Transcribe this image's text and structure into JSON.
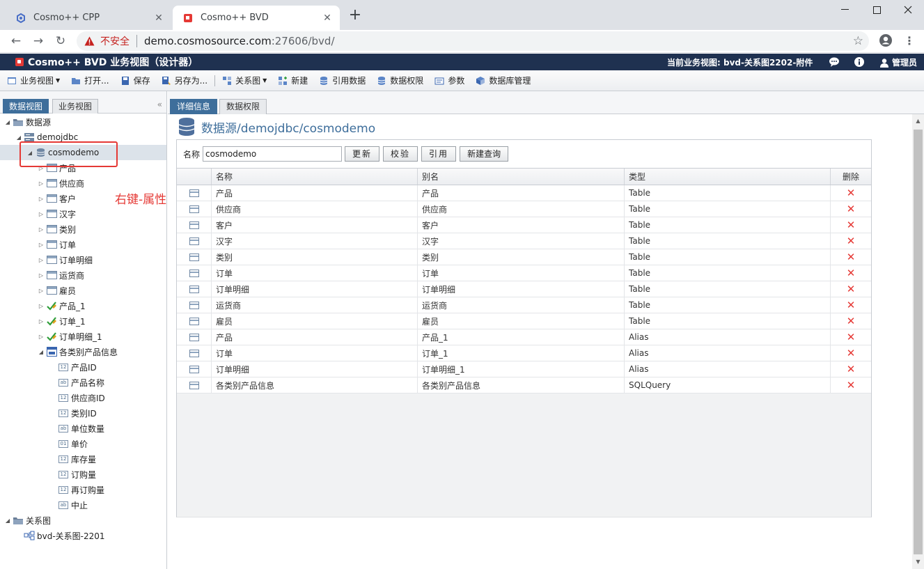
{
  "browser": {
    "tabs": [
      {
        "label": "Cosmo++ CPP",
        "active": false,
        "icon": "cosmo-cpp-icon"
      },
      {
        "label": "Cosmo++ BVD",
        "active": true,
        "icon": "cosmo-bvd-icon"
      }
    ],
    "insecure_label": "不安全",
    "url_host": "demo.cosmosource.com",
    "url_path": ":27606/bvd/"
  },
  "app": {
    "title": "Cosmo++ BVD 业务视图（设计器）",
    "current_view": "当前业务视图: bvd-关系图2202-附件",
    "user": "管理员",
    "header_color": "#1f3150"
  },
  "toolbar": {
    "items": [
      {
        "label": "业务视图",
        "icon": "business-view-icon",
        "dropdown": true
      },
      {
        "label": "打开...",
        "icon": "open-icon"
      },
      {
        "label": "保存",
        "icon": "save-icon"
      },
      {
        "label": "另存为...",
        "icon": "save-as-icon"
      },
      {
        "label": "关系图",
        "icon": "diagram-icon",
        "dropdown": true
      },
      {
        "label": "新建",
        "icon": "new-icon"
      },
      {
        "label": "引用数据",
        "icon": "reference-data-icon"
      },
      {
        "label": "数据权限",
        "icon": "data-permission-icon"
      },
      {
        "label": "参数",
        "icon": "params-icon"
      },
      {
        "label": "数据库管理",
        "icon": "db-manage-icon"
      }
    ]
  },
  "left": {
    "tabs": [
      "数据视图",
      "业务视图"
    ],
    "tree": [
      {
        "label": "数据源",
        "level": 0,
        "expanded": true,
        "icon": "folder-icon"
      },
      {
        "label": "demojdbc",
        "level": 1,
        "expanded": true,
        "icon": "server-icon"
      },
      {
        "label": "cosmodemo",
        "level": 2,
        "expanded": true,
        "icon": "database-icon",
        "selected": true
      },
      {
        "label": "产品",
        "level": 3,
        "expanded": false,
        "icon": "table-icon"
      },
      {
        "label": "供应商",
        "level": 3,
        "expanded": false,
        "icon": "table-icon"
      },
      {
        "label": "客户",
        "level": 3,
        "expanded": false,
        "icon": "table-icon"
      },
      {
        "label": "汉字",
        "level": 3,
        "expanded": false,
        "icon": "table-icon"
      },
      {
        "label": "类别",
        "level": 3,
        "expanded": false,
        "icon": "table-icon"
      },
      {
        "label": "订单",
        "level": 3,
        "expanded": false,
        "icon": "table-icon"
      },
      {
        "label": "订单明细",
        "level": 3,
        "expanded": false,
        "icon": "table-icon"
      },
      {
        "label": "运货商",
        "level": 3,
        "expanded": false,
        "icon": "table-icon"
      },
      {
        "label": "雇员",
        "level": 3,
        "expanded": false,
        "icon": "table-icon"
      },
      {
        "label": "产品_1",
        "level": 3,
        "expanded": false,
        "icon": "alias-icon"
      },
      {
        "label": "订单_1",
        "level": 3,
        "expanded": false,
        "icon": "alias-icon"
      },
      {
        "label": "订单明细_1",
        "level": 3,
        "expanded": false,
        "icon": "alias-icon"
      },
      {
        "label": "各类别产品信息",
        "level": 3,
        "expanded": true,
        "icon": "sql-query-icon"
      },
      {
        "label": "产品ID",
        "level": 4,
        "icon": "field-icon",
        "ftype": "12"
      },
      {
        "label": "产品名称",
        "level": 4,
        "icon": "field-icon",
        "ftype": "ab"
      },
      {
        "label": "供应商ID",
        "level": 4,
        "icon": "field-icon",
        "ftype": "12"
      },
      {
        "label": "类别ID",
        "level": 4,
        "icon": "field-icon",
        "ftype": "12"
      },
      {
        "label": "单位数量",
        "level": 4,
        "icon": "field-icon",
        "ftype": "ab"
      },
      {
        "label": "单价",
        "level": 4,
        "icon": "field-icon",
        "ftype": "01"
      },
      {
        "label": "库存量",
        "level": 4,
        "icon": "field-icon",
        "ftype": "12"
      },
      {
        "label": "订购量",
        "level": 4,
        "icon": "field-icon",
        "ftype": "12"
      },
      {
        "label": "再订购量",
        "level": 4,
        "icon": "field-icon",
        "ftype": "12"
      },
      {
        "label": "中止",
        "level": 4,
        "icon": "field-icon",
        "ftype": "ab"
      },
      {
        "label": "关系图",
        "level": 0,
        "expanded": true,
        "icon": "folder-icon"
      },
      {
        "label": "bvd-关系图-2201",
        "level": 1,
        "icon": "diagram-icon"
      }
    ]
  },
  "annotation": "右键-属性",
  "right": {
    "tabs": [
      "详细信息",
      "数据权限"
    ],
    "title": "数据源/demojdbc/cosmodemo",
    "form": {
      "name_label": "名称",
      "name_value": "cosmodemo",
      "buttons": [
        "更新",
        "校验",
        "引用",
        "新建查询"
      ]
    },
    "columns": [
      "名称",
      "别名",
      "类型",
      "删除"
    ],
    "rows": [
      {
        "name": "产品",
        "alias": "产品",
        "type": "Table"
      },
      {
        "name": "供应商",
        "alias": "供应商",
        "type": "Table"
      },
      {
        "name": "客户",
        "alias": "客户",
        "type": "Table"
      },
      {
        "name": "汉字",
        "alias": "汉字",
        "type": "Table"
      },
      {
        "name": "类别",
        "alias": "类别",
        "type": "Table"
      },
      {
        "name": "订单",
        "alias": "订单",
        "type": "Table"
      },
      {
        "name": "订单明细",
        "alias": "订单明细",
        "type": "Table"
      },
      {
        "name": "运货商",
        "alias": "运货商",
        "type": "Table"
      },
      {
        "name": "雇员",
        "alias": "雇员",
        "type": "Table"
      },
      {
        "name": "产品",
        "alias": "产品_1",
        "type": "Alias"
      },
      {
        "name": "订单",
        "alias": "订单_1",
        "type": "Alias"
      },
      {
        "name": "订单明细",
        "alias": "订单明细_1",
        "type": "Alias"
      },
      {
        "name": "各类别产品信息",
        "alias": "各类别产品信息",
        "type": "SQLQuery"
      }
    ],
    "delete_symbol": "✕"
  },
  "colors": {
    "accent": "#3e6e9b",
    "danger": "#e53935"
  }
}
